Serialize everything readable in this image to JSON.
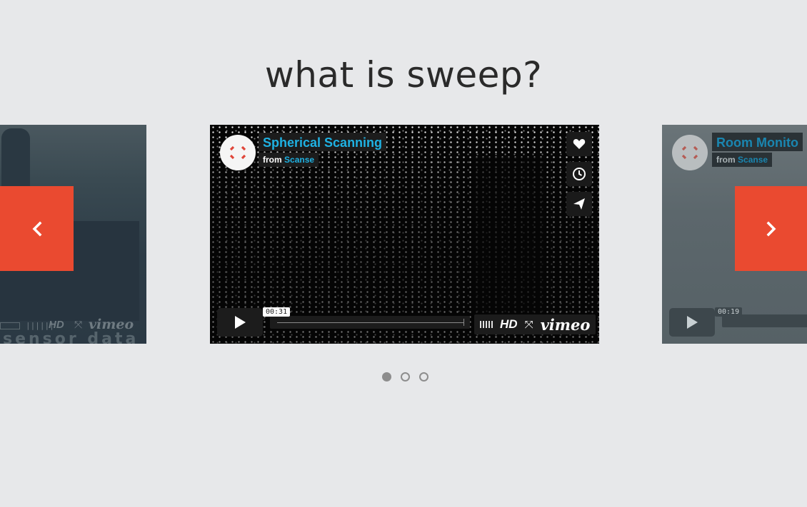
{
  "page": {
    "title": "what is sweep?"
  },
  "carousel": {
    "prev_label": "previous slide",
    "next_label": "next slide",
    "dots": 3,
    "active_index": 0,
    "slides": [
      {
        "position": "left",
        "overlay_text": "sensor data",
        "hd": "HD",
        "vimeo": "vimeo"
      },
      {
        "position": "center",
        "title": "Spherical Scanning",
        "from": "from",
        "author": "Scanse",
        "time": "00:31",
        "hd": "HD",
        "vimeo": "vimeo",
        "progress_fraction": 0.0
      },
      {
        "position": "right",
        "title": "Room Monito",
        "from": "from",
        "author": "Scanse",
        "time": "00:19"
      }
    ]
  },
  "colors": {
    "accent": "#ea4a30",
    "link": "#1fb2e3",
    "background": "#e7e8ea"
  },
  "icons": [
    "chevron-left-icon",
    "chevron-right-icon",
    "heart-icon",
    "clock-icon",
    "send-icon",
    "play-icon",
    "fullscreen-icon"
  ]
}
